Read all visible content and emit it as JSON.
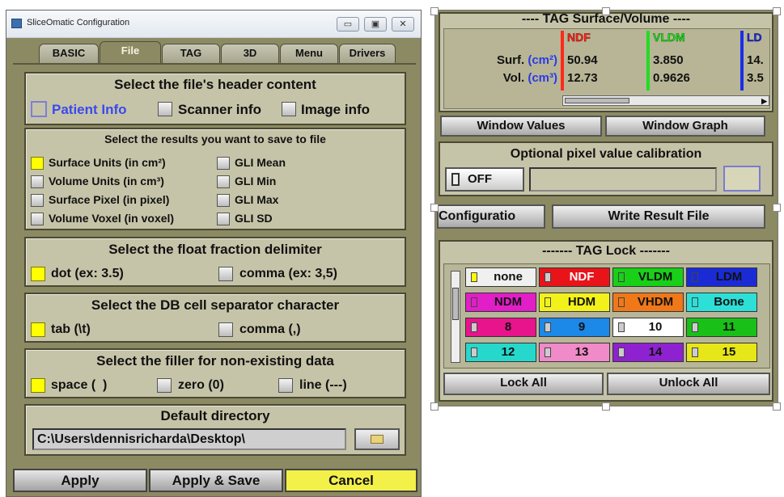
{
  "window": {
    "title": "SliceOmatic Configuration",
    "controls": {
      "minimize": "▭",
      "maximize": "▣",
      "close": "✕"
    }
  },
  "tabs": [
    "BASIC",
    "File",
    "TAG",
    "3D",
    "Menu",
    "Drivers"
  ],
  "active_tab": "File",
  "header_content": {
    "title": "Select the file's header content",
    "options": [
      {
        "label": "Patient Info",
        "state": "focused"
      },
      {
        "label": "Scanner info",
        "state": "unchecked"
      },
      {
        "label": "Image info",
        "state": "unchecked"
      }
    ]
  },
  "results": {
    "title": "Select the results you want to save to file",
    "left": [
      "Surface Units (in cm²)",
      "Volume Units (in cm³)",
      "Surface Pixel (in pixel)",
      "Volume Voxel (in voxel)"
    ],
    "left_checked": [
      true,
      false,
      false,
      false
    ],
    "right": [
      "GLI Mean",
      "GLI Min",
      "GLI Max",
      "GLI SD"
    ]
  },
  "float_delimiter": {
    "title": "Select the float fraction delimiter",
    "options": [
      {
        "label": "dot (ex: 3.5)",
        "checked": true
      },
      {
        "label": "comma (ex: 3,5)",
        "checked": false
      }
    ]
  },
  "db_separator": {
    "title": "Select the DB cell separator character",
    "options": [
      {
        "label": "tab (\\t)",
        "checked": true
      },
      {
        "label": "comma (,)",
        "checked": false
      }
    ]
  },
  "filler": {
    "title": "Select the filler for non-existing data",
    "options": [
      {
        "label": "space (  )",
        "checked": true
      },
      {
        "label": "zero (0)",
        "checked": false
      },
      {
        "label": "line (---)",
        "checked": false
      }
    ]
  },
  "default_directory": {
    "title": "Default directory",
    "value": "C:\\Users\\dennisricharda\\Desktop\\",
    "browse_icon": "folder-icon"
  },
  "footer": {
    "apply": "Apply",
    "apply_save": "Apply & Save",
    "cancel": "Cancel"
  },
  "tag_surface": {
    "title": "---- TAG Surface/Volume ----",
    "row_labels": {
      "surf": "Surf.",
      "surf_unit": "(cm²)",
      "vol": "Vol.",
      "vol_unit": "(cm³)"
    },
    "columns": [
      {
        "name": "NDF",
        "color": "#ff2a1a",
        "surf": "50.94",
        "vol": "12.73"
      },
      {
        "name": "VLDM",
        "color": "#22dd22",
        "surf": "3.850",
        "vol": "0.9626"
      },
      {
        "name": "LD",
        "color": "#1a2ee8",
        "surf": "14.",
        "vol": "3.5"
      }
    ]
  },
  "window_buttons": {
    "values": "Window Values",
    "graph": "Window Graph"
  },
  "calibration": {
    "title": "Optional pixel value calibration",
    "toggle": "OFF"
  },
  "actions": {
    "configuration": "Configuratio",
    "write": "Write Result File"
  },
  "tag_lock": {
    "title": "------- TAG Lock -------",
    "tags": [
      {
        "label": "none",
        "bg": "#f0f0f0",
        "fg": "#111",
        "sw": "#ffff00"
      },
      {
        "label": "NDF",
        "bg": "#e8141a",
        "fg": "#ffffff",
        "sw": "#cccccc"
      },
      {
        "label": "VLDM",
        "bg": "#18d018",
        "fg": "#111",
        "sw": "#18d018"
      },
      {
        "label": "LDM",
        "bg": "#1a2bd6",
        "fg": "#111",
        "sw": "#1a2bd6"
      },
      {
        "label": "NDM",
        "bg": "#e21ec8",
        "fg": "#111",
        "sw": "#e21ec8"
      },
      {
        "label": "HDM",
        "bg": "#f2f21a",
        "fg": "#111",
        "sw": "#f2f21a"
      },
      {
        "label": "VHDM",
        "bg": "#f07818",
        "fg": "#111",
        "sw": "#f07818"
      },
      {
        "label": "Bone",
        "bg": "#2ce0d8",
        "fg": "#111",
        "sw": "#2ce0d8"
      },
      {
        "label": "8",
        "bg": "#e8148c",
        "fg": "#111",
        "sw": "#cccccc"
      },
      {
        "label": "9",
        "bg": "#1c88e8",
        "fg": "#111",
        "sw": "#cccccc"
      },
      {
        "label": "10",
        "bg": "#ffffff",
        "fg": "#111",
        "sw": "#cccccc"
      },
      {
        "label": "11",
        "bg": "#18c018",
        "fg": "#111",
        "sw": "#cccccc"
      },
      {
        "label": "12",
        "bg": "#26d8cc",
        "fg": "#111",
        "sw": "#cccccc"
      },
      {
        "label": "13",
        "bg": "#f08ac8",
        "fg": "#111",
        "sw": "#cccccc"
      },
      {
        "label": "14",
        "bg": "#8e22d0",
        "fg": "#111",
        "sw": "#cccccc"
      },
      {
        "label": "15",
        "bg": "#e6e618",
        "fg": "#111",
        "sw": "#cccccc"
      }
    ],
    "lock_all": "Lock All",
    "unlock_all": "Unlock All"
  }
}
